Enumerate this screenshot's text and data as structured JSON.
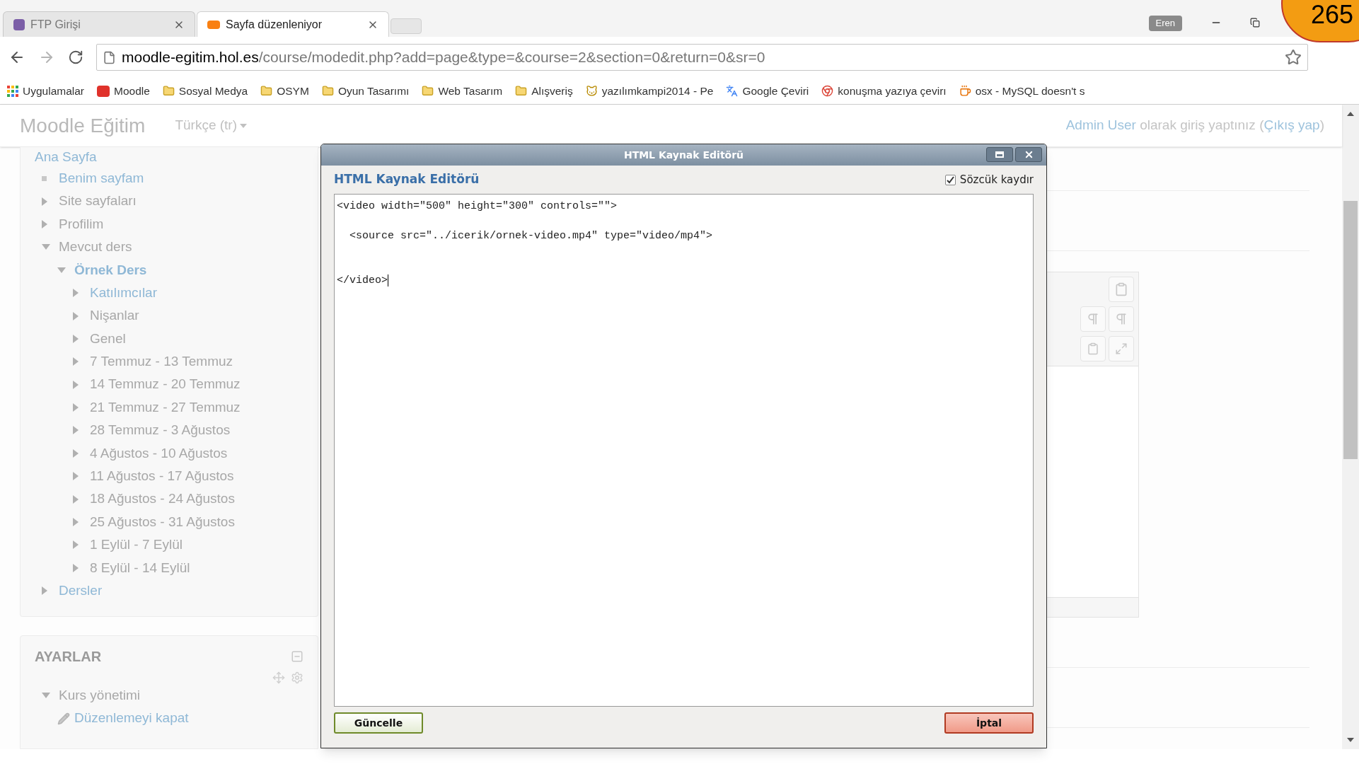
{
  "browser": {
    "tabs": [
      {
        "title": "FTP Girişi",
        "selected": false
      },
      {
        "title": "Sayfa düzenleniyor",
        "selected": true
      }
    ],
    "profile": "Eren",
    "address": {
      "host": "moodle-egitim.hol.es",
      "path": "/course/modedit.php?add=page&type=&course=2&section=0&return=0&sr=0"
    },
    "bookmarks": [
      {
        "label": "Uygulamalar",
        "kind": "apps"
      },
      {
        "label": "Moodle",
        "kind": "moodle"
      },
      {
        "label": "Sosyal Medya",
        "kind": "folder"
      },
      {
        "label": "OSYM",
        "kind": "folder"
      },
      {
        "label": "Oyun Tasarımı",
        "kind": "folder"
      },
      {
        "label": "Web Tasarım",
        "kind": "folder"
      },
      {
        "label": "Alışveriş",
        "kind": "folder"
      },
      {
        "label": "yazılımkampi2014 - Pe",
        "kind": "site"
      },
      {
        "label": "Google Çeviri",
        "kind": "translate"
      },
      {
        "label": "konuşma yazıya çevirı",
        "kind": "chrome"
      },
      {
        "label": "osx - MySQL doesn't s",
        "kind": "java"
      }
    ]
  },
  "counter": "265",
  "site": {
    "title": "Moodle Eğitim",
    "language": "Türkçe (tr)",
    "login": {
      "user": "Admin User",
      "text": "olarak giriş yaptınız (",
      "logout": "Çıkış yap",
      "end": ")"
    }
  },
  "navigation": {
    "home": "Ana Sayfa",
    "items": [
      {
        "label": "Benim sayfam",
        "kind": "bullet",
        "link": true
      },
      {
        "label": "Site sayfaları",
        "kind": "node",
        "link": false,
        "expanded": false
      },
      {
        "label": "Profilim",
        "kind": "node",
        "link": false,
        "expanded": false
      },
      {
        "label": "Mevcut ders",
        "kind": "node",
        "link": false,
        "expanded": true,
        "children": [
          {
            "label": "Örnek Ders",
            "kind": "course",
            "link": true,
            "expanded": true,
            "children": [
              {
                "label": "Katılımcılar",
                "kind": "node",
                "link": true,
                "expanded": false
              },
              {
                "label": "Nişanlar",
                "kind": "node",
                "link": false,
                "expanded": false
              },
              {
                "label": "Genel",
                "kind": "node",
                "link": false,
                "expanded": false
              },
              {
                "label": "7 Temmuz - 13 Temmuz",
                "kind": "node",
                "link": false,
                "expanded": false
              },
              {
                "label": "14 Temmuz - 20 Temmuz",
                "kind": "node",
                "link": false,
                "expanded": false
              },
              {
                "label": "21 Temmuz - 27 Temmuz",
                "kind": "node",
                "link": false,
                "expanded": false
              },
              {
                "label": "28 Temmuz - 3 Ağustos",
                "kind": "node",
                "link": false,
                "expanded": false
              },
              {
                "label": "4 Ağustos - 10 Ağustos",
                "kind": "node",
                "link": false,
                "expanded": false
              },
              {
                "label": "11 Ağustos - 17 Ağustos",
                "kind": "node",
                "link": false,
                "expanded": false
              },
              {
                "label": "18 Ağustos - 24 Ağustos",
                "kind": "node",
                "link": false,
                "expanded": false
              },
              {
                "label": "25 Ağustos - 31 Ağustos",
                "kind": "node",
                "link": false,
                "expanded": false
              },
              {
                "label": "1 Eylül - 7 Eylül",
                "kind": "node",
                "link": false,
                "expanded": false
              },
              {
                "label": "8 Eylül - 14 Eylül",
                "kind": "node",
                "link": false,
                "expanded": false
              }
            ]
          }
        ]
      },
      {
        "label": "Dersler",
        "kind": "node",
        "link": true,
        "expanded": false
      }
    ]
  },
  "settings": {
    "title": "AYARLAR",
    "items": [
      {
        "label": "Kurs yönetimi",
        "kind": "node",
        "link": false,
        "expanded": true,
        "children": [
          {
            "label": "Düzenlemeyi kapat",
            "kind": "pencil",
            "link": true
          }
        ]
      }
    ]
  },
  "dialog": {
    "title": "HTML Kaynak Editörü",
    "heading": "HTML Kaynak Editörü",
    "word_wrap": {
      "label": "Sözcük kaydır",
      "checked": true
    },
    "code_lines": [
      {
        "kind": "code",
        "text": "<video width=\"500\" height=\"300\" controls=\"\">"
      },
      {
        "kind": "blank"
      },
      {
        "kind": "code",
        "text": "  <source src=\"../icerik/ornek-video.mp4\" type=\"video/mp4\">"
      },
      {
        "kind": "blank"
      },
      {
        "kind": "blank"
      },
      {
        "kind": "code",
        "text": "</video>"
      }
    ],
    "buttons": [
      {
        "label": "Güncelle",
        "kind": "confirm"
      },
      {
        "label": "İptal",
        "kind": "cancel"
      }
    ]
  }
}
